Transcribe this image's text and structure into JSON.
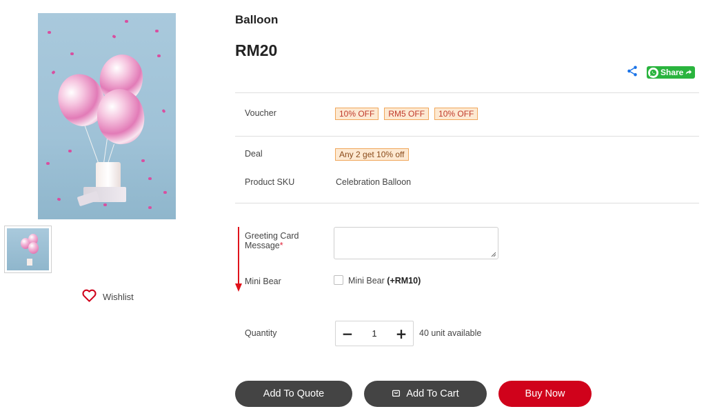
{
  "product": {
    "title": "Balloon",
    "price": "RM20"
  },
  "share": {
    "share_icon": "share-icon",
    "whatsapp_label": "Share"
  },
  "details": {
    "voucher_label": "Voucher",
    "vouchers": [
      "10% OFF",
      "RM5 OFF",
      "10% OFF"
    ],
    "deal_label": "Deal",
    "deal_value": "Any 2 get 10% off",
    "sku_label": "Product SKU",
    "sku_value": "Celebration Balloon"
  },
  "form": {
    "greeting_label": "Greeting Card Message",
    "greeting_required_mark": "*",
    "greeting_value": "",
    "addon_label": "Mini Bear",
    "addon_option_name": "Mini Bear",
    "addon_option_price": "(+RM10)",
    "addon_checked": false,
    "quantity_label": "Quantity",
    "quantity_minus": "−",
    "quantity_value": "1",
    "quantity_plus": "+",
    "stock_text": "40 unit available"
  },
  "actions": {
    "add_to_quote": "Add To Quote",
    "add_to_cart": "Add To Cart",
    "buy_now": "Buy Now"
  },
  "gallery": {
    "wishlist_label": "Wishlist"
  },
  "colors": {
    "buy_now": "#d0021b",
    "dark_button": "#444444",
    "whatsapp": "#2ab43e",
    "tag_border": "#f0a65a",
    "tag_bg": "#fde9d2",
    "share_icon": "#1a73e8",
    "annotation_arrow": "#e0131b"
  }
}
